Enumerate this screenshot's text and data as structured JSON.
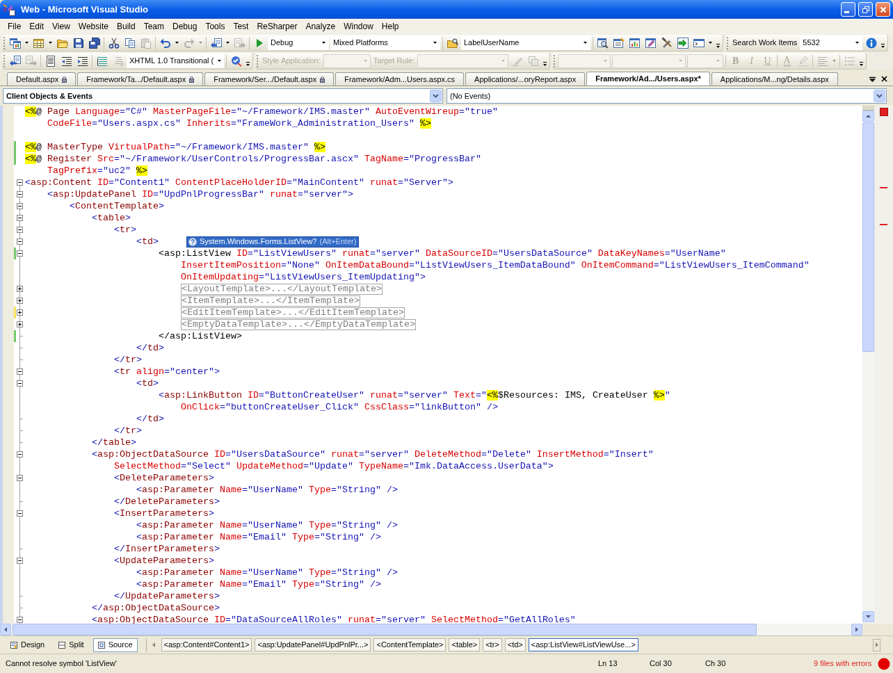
{
  "window": {
    "title": "Web - Microsoft Visual Studio"
  },
  "menu": [
    "File",
    "Edit",
    "View",
    "Website",
    "Build",
    "Team",
    "Debug",
    "Tools",
    "Test",
    "ReSharper",
    "Analyze",
    "Window",
    "Help"
  ],
  "toolbar_rows": [
    {
      "toolbars": [
        {
          "items": [
            {
              "kind": "button",
              "dropdown": true,
              "disabled": false
            },
            {
              "kind": "button",
              "dropdown": true,
              "disabled": false
            },
            {
              "kind": "button",
              "dropdown": false,
              "disabled": false
            },
            {
              "kind": "button",
              "dropdown": false,
              "disabled": false
            },
            {
              "kind": "button",
              "dropdown": false,
              "disabled": false
            },
            {
              "kind": "separator"
            },
            {
              "kind": "button",
              "dropdown": false,
              "disabled": false
            },
            {
              "kind": "button",
              "dropdown": false,
              "disabled": false
            },
            {
              "kind": "button",
              "dropdown": false,
              "disabled": true
            },
            {
              "kind": "separator"
            },
            {
              "kind": "button",
              "dropdown": true,
              "disabled": false
            },
            {
              "kind": "button",
              "dropdown": true,
              "disabled": true
            },
            {
              "kind": "separator"
            },
            {
              "kind": "button",
              "dropdown": true,
              "disabled": false
            },
            {
              "kind": "button",
              "dropdown": false,
              "disabled": true
            },
            {
              "kind": "separator"
            },
            {
              "kind": "button",
              "dropdown": false,
              "disabled": false
            },
            {
              "kind": "combo",
              "value": "Debug",
              "disabled": false
            },
            {
              "kind": "combo",
              "value": "Mixed Platforms",
              "disabled": false
            },
            {
              "kind": "separator"
            },
            {
              "kind": "button",
              "dropdown": false,
              "disabled": false
            },
            {
              "kind": "combo",
              "value": "LabelUserName",
              "disabled": false
            },
            {
              "kind": "separator"
            },
            {
              "kind": "button",
              "dropdown": false,
              "disabled": false
            },
            {
              "kind": "button",
              "dropdown": false,
              "disabled": false
            },
            {
              "kind": "button",
              "dropdown": false,
              "disabled": false
            },
            {
              "kind": "button",
              "dropdown": false,
              "disabled": false
            },
            {
              "kind": "button",
              "dropdown": false,
              "disabled": false
            },
            {
              "kind": "button",
              "dropdown": false,
              "disabled": false
            },
            {
              "kind": "button",
              "dropdown": true,
              "disabled": false
            },
            {
              "kind": "overflow"
            }
          ]
        },
        {
          "items": [
            {
              "kind": "label",
              "text": "Search Work Items",
              "disabled": false
            },
            {
              "kind": "combo",
              "value": "5532",
              "disabled": false
            },
            {
              "kind": "button",
              "dropdown": false,
              "disabled": false
            },
            {
              "kind": "overflow"
            }
          ]
        }
      ]
    },
    {
      "toolbars": [
        {
          "items": [
            {
              "kind": "button",
              "dropdown": false,
              "disabled": false
            },
            {
              "kind": "button",
              "dropdown": false,
              "disabled": true
            },
            {
              "kind": "separator"
            },
            {
              "kind": "button",
              "dropdown": false,
              "disabled": false
            },
            {
              "kind": "button",
              "dropdown": false,
              "disabled": false
            },
            {
              "kind": "button",
              "dropdown": false,
              "disabled": false
            },
            {
              "kind": "separator"
            },
            {
              "kind": "button",
              "dropdown": false,
              "disabled": false
            },
            {
              "kind": "button",
              "dropdown": false,
              "disabled": true
            },
            {
              "kind": "combo",
              "value": "XHTML 1.0 Transitional (",
              "disabled": false
            },
            {
              "kind": "separator"
            },
            {
              "kind": "button",
              "dropdown": false,
              "disabled": false
            },
            {
              "kind": "overflow"
            }
          ]
        },
        {
          "items": [
            {
              "kind": "label",
              "text": "Style Application:",
              "disabled": true
            },
            {
              "kind": "combo",
              "disabled": true
            },
            {
              "kind": "label",
              "text": "Target Rule:",
              "disabled": true
            },
            {
              "kind": "combo",
              "disabled": true
            },
            {
              "kind": "button",
              "dropdown": false,
              "disabled": true
            },
            {
              "kind": "button",
              "dropdown": false,
              "disabled": true
            },
            {
              "kind": "overflow"
            }
          ]
        },
        {
          "items": [
            {
              "kind": "combo",
              "disabled": true
            },
            {
              "kind": "combo",
              "disabled": true
            },
            {
              "kind": "combo",
              "disabled": true
            },
            {
              "kind": "separator"
            },
            {
              "kind": "text_button",
              "label": "B",
              "disabled": true
            },
            {
              "kind": "text_button",
              "label": "I",
              "disabled": true
            },
            {
              "kind": "text_button",
              "label": "U",
              "disabled": true
            },
            {
              "kind": "separator"
            },
            {
              "kind": "text_button",
              "label": "A",
              "disabled": true
            },
            {
              "kind": "button",
              "dropdown": false,
              "disabled": true
            },
            {
              "kind": "separator"
            },
            {
              "kind": "button",
              "dropdown": true,
              "disabled": true
            },
            {
              "kind": "separator"
            },
            {
              "kind": "button",
              "dropdown": false,
              "disabled": true
            },
            {
              "kind": "overflow"
            }
          ]
        }
      ]
    }
  ],
  "tabs": [
    {
      "label": "Default.aspx",
      "locked": true,
      "selected": false
    },
    {
      "label": "Framework/Ta.../Default.aspx",
      "locked": true,
      "selected": false
    },
    {
      "label": "Framework/Ser.../Default.aspx",
      "locked": true,
      "selected": false
    },
    {
      "label": "Framework/Adm...Users.aspx.cs",
      "locked": false,
      "selected": false
    },
    {
      "label": "Applications/...oryReport.aspx",
      "locked": false,
      "selected": false
    },
    {
      "label": "Framework/Ad.../Users.aspx*",
      "locked": false,
      "selected": true
    },
    {
      "label": "Applications/M...ng/Details.aspx",
      "locked": false,
      "selected": false
    }
  ],
  "navigation": {
    "objects": "Client Objects & Events",
    "events": "(No Events)"
  },
  "editor": {
    "lines": [
      {
        "kind": "plain",
        "tokens": [
          {
            "kind": "delimiter",
            "text": "<%"
          },
          {
            "kind": "text",
            "text": "@"
          },
          {
            "kind": "element",
            "text": " Page"
          },
          {
            "kind": "attribute",
            "text": " Language"
          },
          {
            "kind": "markup",
            "text": "=\"C#\""
          },
          {
            "kind": "attribute",
            "text": " MasterPageFile"
          },
          {
            "kind": "markup",
            "text": "=\"~/Framework/IMS.master\""
          },
          {
            "kind": "attribute",
            "text": " AutoEventWireup"
          },
          {
            "kind": "markup",
            "text": "=\"true\""
          }
        ]
      },
      {
        "kind": "plain",
        "tokens": [
          {
            "kind": "attribute",
            "text": "    CodeFile"
          },
          {
            "kind": "markup",
            "text": "=\"Users.aspx.cs\""
          },
          {
            "kind": "attribute",
            "text": " Inherits"
          },
          {
            "kind": "markup",
            "text": "=\"FrameWork_Administration_Users\" "
          },
          {
            "kind": "delimiter",
            "text": "%>"
          }
        ]
      },
      {
        "kind": "plain"
      },
      {
        "kind": "plain",
        "color": "#74c96a",
        "tokens": [
          {
            "kind": "delimiter",
            "text": "<%"
          },
          {
            "kind": "text",
            "text": "@"
          },
          {
            "kind": "element",
            "text": " MasterType"
          },
          {
            "kind": "attribute",
            "text": " VirtualPath"
          },
          {
            "kind": "markup",
            "text": "=\"~/Framework/IMS.master\" "
          },
          {
            "kind": "delimiter",
            "text": "%>"
          }
        ]
      },
      {
        "kind": "plain",
        "color": "#74c96a",
        "tokens": [
          {
            "kind": "delimiter",
            "text": "<%"
          },
          {
            "kind": "text",
            "text": "@"
          },
          {
            "kind": "element",
            "text": " Register"
          },
          {
            "kind": "attribute",
            "text": " Src"
          },
          {
            "kind": "markup",
            "text": "=\"~/Framework/UserControls/ProgressBar.ascx\""
          },
          {
            "kind": "attribute",
            "text": " TagName"
          },
          {
            "kind": "markup",
            "text": "=\"ProgressBar\""
          }
        ]
      },
      {
        "kind": "plain",
        "tokens": [
          {
            "kind": "attribute",
            "text": "    TagPrefix"
          },
          {
            "kind": "markup",
            "text": "=\"uc2\" "
          },
          {
            "kind": "delimiter",
            "text": "%>"
          }
        ]
      },
      {
        "kind": "start",
        "expanded": true,
        "tokens": [
          {
            "kind": "markup",
            "text": "<"
          },
          {
            "kind": "element",
            "text": "asp:Content"
          },
          {
            "kind": "attribute",
            "text": " ID"
          },
          {
            "kind": "markup",
            "text": "=\"Content1\""
          },
          {
            "kind": "attribute",
            "text": " ContentPlaceHolderID"
          },
          {
            "kind": "markup",
            "text": "=\"MainContent\""
          },
          {
            "kind": "attribute",
            "text": " runat"
          },
          {
            "kind": "markup",
            "text": "=\"Server\">"
          }
        ]
      },
      {
        "kind": "start",
        "expanded": true,
        "tokens": [
          {
            "kind": "markup",
            "text": "    <"
          },
          {
            "kind": "element",
            "text": "asp:UpdatePanel"
          },
          {
            "kind": "attribute",
            "text": " ID"
          },
          {
            "kind": "markup",
            "text": "=\"UpdPnlProgressBar\""
          },
          {
            "kind": "attribute",
            "text": " runat"
          },
          {
            "kind": "markup",
            "text": "=\"server\">"
          }
        ]
      },
      {
        "kind": "start",
        "expanded": true,
        "tokens": [
          {
            "kind": "markup",
            "text": "        <"
          },
          {
            "kind": "element",
            "text": "ContentTemplate"
          },
          {
            "kind": "markup",
            "text": ">"
          }
        ]
      },
      {
        "kind": "start",
        "expanded": true,
        "tokens": [
          {
            "kind": "markup",
            "text": "            <"
          },
          {
            "kind": "element",
            "text": "table"
          },
          {
            "kind": "markup",
            "text": ">"
          }
        ]
      },
      {
        "kind": "start",
        "expanded": true,
        "tokens": [
          {
            "kind": "markup",
            "text": "                <"
          },
          {
            "kind": "element",
            "text": "tr"
          },
          {
            "kind": "markup",
            "text": ">"
          }
        ]
      },
      {
        "kind": "start",
        "expanded": true,
        "tokens": [
          {
            "kind": "markup",
            "text": "                    <"
          },
          {
            "kind": "element",
            "text": "td"
          },
          {
            "kind": "markup",
            "text": ">"
          }
        ],
        "quick_fix": {
          "text": "System.Windows.Forms.ListView?",
          "shortcut": "(Alt+Enter)"
        }
      },
      {
        "kind": "start",
        "expanded": true,
        "color": "#74c96a",
        "tokens": [
          {
            "kind": "matched",
            "text": "                        <asp:ListView"
          },
          {
            "kind": "attribute",
            "text": " ID"
          },
          {
            "kind": "markup",
            "text": "=\"ListViewUsers\""
          },
          {
            "kind": "attribute",
            "text": " runat"
          },
          {
            "kind": "markup",
            "text": "=\"server\""
          },
          {
            "kind": "attribute",
            "text": " DataSourceID"
          },
          {
            "kind": "markup",
            "text": "=\"UsersDataSource\""
          },
          {
            "kind": "attribute",
            "text": " DataKeyNames"
          },
          {
            "kind": "markup",
            "text": "=\"UserName\""
          }
        ]
      },
      {
        "kind": "inside",
        "tokens": [
          {
            "kind": "attribute",
            "text": "                            InsertItemPosition"
          },
          {
            "kind": "markup",
            "text": "=\"None\""
          },
          {
            "kind": "attribute",
            "text": " OnItemDataBound"
          },
          {
            "kind": "markup",
            "text": "=\"ListViewUsers_ItemDataBound\""
          },
          {
            "kind": "attribute",
            "text": " OnItemCommand"
          },
          {
            "kind": "markup",
            "text": "=\"ListViewUsers_ItemCommand\""
          }
        ]
      },
      {
        "kind": "inside",
        "tokens": [
          {
            "kind": "attribute",
            "text": "                            OnItemUpdating"
          },
          {
            "kind": "markup",
            "text": "=\"ListViewUsers_ItemUpdating\">"
          }
        ]
      },
      {
        "kind": "start",
        "expanded": false,
        "tokens": [
          {
            "kind": "collapsed",
            "text": "                            <LayoutTemplate>...</LayoutTemplate>"
          }
        ]
      },
      {
        "kind": "start",
        "expanded": false,
        "tokens": [
          {
            "kind": "collapsed",
            "text": "                            <ItemTemplate>...</ItemTemplate>"
          }
        ]
      },
      {
        "kind": "start",
        "expanded": false,
        "color": "#f6e35c",
        "tokens": [
          {
            "kind": "collapsed",
            "text": "                            <EditItemTemplate>...</EditItemTemplate>"
          }
        ]
      },
      {
        "kind": "start",
        "expanded": false,
        "tokens": [
          {
            "kind": "collapsed",
            "text": "                            <EmptyDataTemplate>...</EmptyDataTemplate>"
          }
        ]
      },
      {
        "kind": "end",
        "color": "#74c96a",
        "tokens": [
          {
            "kind": "matched",
            "text": "                        </asp:ListView>"
          }
        ]
      },
      {
        "kind": "end",
        "tokens": [
          {
            "kind": "markup",
            "text": "                    </"
          },
          {
            "kind": "element",
            "text": "td"
          },
          {
            "kind": "markup",
            "text": ">"
          }
        ]
      },
      {
        "kind": "end",
        "tokens": [
          {
            "kind": "markup",
            "text": "                </"
          },
          {
            "kind": "element",
            "text": "tr"
          },
          {
            "kind": "markup",
            "text": ">"
          }
        ]
      },
      {
        "kind": "start",
        "expanded": true,
        "tokens": [
          {
            "kind": "markup",
            "text": "                <"
          },
          {
            "kind": "element",
            "text": "tr"
          },
          {
            "kind": "attribute",
            "text": " align"
          },
          {
            "kind": "markup",
            "text": "=\"center\">"
          }
        ]
      },
      {
        "kind": "start",
        "expanded": true,
        "tokens": [
          {
            "kind": "markup",
            "text": "                    <"
          },
          {
            "kind": "element",
            "text": "td"
          },
          {
            "kind": "markup",
            "text": ">"
          }
        ]
      },
      {
        "kind": "inside",
        "tokens": [
          {
            "kind": "markup",
            "text": "                        <"
          },
          {
            "kind": "element",
            "text": "asp:LinkButton"
          },
          {
            "kind": "attribute",
            "text": " ID"
          },
          {
            "kind": "markup",
            "text": "=\"ButtonCreateUser\""
          },
          {
            "kind": "attribute",
            "text": " runat"
          },
          {
            "kind": "markup",
            "text": "=\"server\""
          },
          {
            "kind": "attribute",
            "text": " Text"
          },
          {
            "kind": "markup",
            "text": "=\""
          },
          {
            "kind": "delimiter",
            "text": "<%"
          },
          {
            "kind": "text",
            "text": "$Resources: IMS, CreateUser "
          },
          {
            "kind": "delimiter",
            "text": "%>"
          },
          {
            "kind": "markup",
            "text": "\""
          }
        ]
      },
      {
        "kind": "inside",
        "tokens": [
          {
            "kind": "attribute",
            "text": "                            OnClick"
          },
          {
            "kind": "markup",
            "text": "=\"buttonCreateUser_Click\""
          },
          {
            "kind": "attribute",
            "text": " CssClass"
          },
          {
            "kind": "markup",
            "text": "=\"linkButton\" />"
          }
        ]
      },
      {
        "kind": "end",
        "tokens": [
          {
            "kind": "markup",
            "text": "                    </"
          },
          {
            "kind": "element",
            "text": "td"
          },
          {
            "kind": "markup",
            "text": ">"
          }
        ]
      },
      {
        "kind": "end",
        "tokens": [
          {
            "kind": "markup",
            "text": "                </"
          },
          {
            "kind": "element",
            "text": "tr"
          },
          {
            "kind": "markup",
            "text": ">"
          }
        ]
      },
      {
        "kind": "end",
        "tokens": [
          {
            "kind": "markup",
            "text": "            </"
          },
          {
            "kind": "element",
            "text": "table"
          },
          {
            "kind": "markup",
            "text": ">"
          }
        ]
      },
      {
        "kind": "start",
        "expanded": true,
        "tokens": [
          {
            "kind": "markup",
            "text": "            <"
          },
          {
            "kind": "element",
            "text": "asp:ObjectDataSource"
          },
          {
            "kind": "attribute",
            "text": " ID"
          },
          {
            "kind": "markup",
            "text": "=\"UsersDataSource\""
          },
          {
            "kind": "attribute",
            "text": " runat"
          },
          {
            "kind": "markup",
            "text": "=\"server\""
          },
          {
            "kind": "attribute",
            "text": " DeleteMethod"
          },
          {
            "kind": "markup",
            "text": "=\"Delete\""
          },
          {
            "kind": "attribute",
            "text": " InsertMethod"
          },
          {
            "kind": "markup",
            "text": "=\"Insert\""
          }
        ]
      },
      {
        "kind": "inside",
        "tokens": [
          {
            "kind": "attribute",
            "text": "                SelectMethod"
          },
          {
            "kind": "markup",
            "text": "=\"Select\""
          },
          {
            "kind": "attribute",
            "text": " UpdateMethod"
          },
          {
            "kind": "markup",
            "text": "=\"Update\""
          },
          {
            "kind": "attribute",
            "text": " TypeName"
          },
          {
            "kind": "markup",
            "text": "=\"Imk.DataAccess.UserData\">"
          }
        ]
      },
      {
        "kind": "start",
        "expanded": true,
        "tokens": [
          {
            "kind": "markup",
            "text": "                <"
          },
          {
            "kind": "element",
            "text": "DeleteParameters"
          },
          {
            "kind": "markup",
            "text": ">"
          }
        ]
      },
      {
        "kind": "inside",
        "tokens": [
          {
            "kind": "markup",
            "text": "                    <"
          },
          {
            "kind": "element",
            "text": "asp:Parameter"
          },
          {
            "kind": "attribute",
            "text": " Name"
          },
          {
            "kind": "markup",
            "text": "=\"UserName\""
          },
          {
            "kind": "attribute",
            "text": " Type"
          },
          {
            "kind": "markup",
            "text": "=\"String\" />"
          }
        ]
      },
      {
        "kind": "end",
        "tokens": [
          {
            "kind": "markup",
            "text": "                </"
          },
          {
            "kind": "element",
            "text": "DeleteParameters"
          },
          {
            "kind": "markup",
            "text": ">"
          }
        ]
      },
      {
        "kind": "start",
        "expanded": true,
        "tokens": [
          {
            "kind": "markup",
            "text": "                <"
          },
          {
            "kind": "element",
            "text": "InsertParameters"
          },
          {
            "kind": "markup",
            "text": ">"
          }
        ]
      },
      {
        "kind": "inside",
        "tokens": [
          {
            "kind": "markup",
            "text": "                    <"
          },
          {
            "kind": "element",
            "text": "asp:Parameter"
          },
          {
            "kind": "attribute",
            "text": " Name"
          },
          {
            "kind": "markup",
            "text": "=\"UserName\""
          },
          {
            "kind": "attribute",
            "text": " Type"
          },
          {
            "kind": "markup",
            "text": "=\"String\" />"
          }
        ]
      },
      {
        "kind": "inside",
        "tokens": [
          {
            "kind": "markup",
            "text": "                    <"
          },
          {
            "kind": "element",
            "text": "asp:Parameter"
          },
          {
            "kind": "attribute",
            "text": " Name"
          },
          {
            "kind": "markup",
            "text": "=\"Email\""
          },
          {
            "kind": "attribute",
            "text": " Type"
          },
          {
            "kind": "markup",
            "text": "=\"String\" />"
          }
        ]
      },
      {
        "kind": "end",
        "tokens": [
          {
            "kind": "markup",
            "text": "                </"
          },
          {
            "kind": "element",
            "text": "InsertParameters"
          },
          {
            "kind": "markup",
            "text": ">"
          }
        ]
      },
      {
        "kind": "start",
        "expanded": true,
        "tokens": [
          {
            "kind": "markup",
            "text": "                <"
          },
          {
            "kind": "element",
            "text": "UpdateParameters"
          },
          {
            "kind": "markup",
            "text": ">"
          }
        ]
      },
      {
        "kind": "inside",
        "tokens": [
          {
            "kind": "markup",
            "text": "                    <"
          },
          {
            "kind": "element",
            "text": "asp:Parameter"
          },
          {
            "kind": "attribute",
            "text": " Name"
          },
          {
            "kind": "markup",
            "text": "=\"UserName\""
          },
          {
            "kind": "attribute",
            "text": " Type"
          },
          {
            "kind": "markup",
            "text": "=\"String\" />"
          }
        ]
      },
      {
        "kind": "inside",
        "tokens": [
          {
            "kind": "markup",
            "text": "                    <"
          },
          {
            "kind": "element",
            "text": "asp:Parameter"
          },
          {
            "kind": "attribute",
            "text": " Name"
          },
          {
            "kind": "markup",
            "text": "=\"Email\""
          },
          {
            "kind": "attribute",
            "text": " Type"
          },
          {
            "kind": "markup",
            "text": "=\"String\" />"
          }
        ]
      },
      {
        "kind": "end",
        "tokens": [
          {
            "kind": "markup",
            "text": "                </"
          },
          {
            "kind": "element",
            "text": "UpdateParameters"
          },
          {
            "kind": "markup",
            "text": ">"
          }
        ]
      },
      {
        "kind": "end",
        "tokens": [
          {
            "kind": "markup",
            "text": "            </"
          },
          {
            "kind": "element",
            "text": "asp:ObjectDataSource"
          },
          {
            "kind": "markup",
            "text": ">"
          }
        ]
      },
      {
        "kind": "start",
        "expanded": true,
        "tokens": [
          {
            "kind": "markup",
            "text": "            <"
          },
          {
            "kind": "element",
            "text": "asp:ObjectDataSource"
          },
          {
            "kind": "attribute",
            "text": " ID"
          },
          {
            "kind": "markup",
            "text": "=\"DataSourceAllRoles\""
          },
          {
            "kind": "attribute",
            "text": " runat"
          },
          {
            "kind": "markup",
            "text": "=\"server\""
          },
          {
            "kind": "attribute",
            "text": " SelectMethod"
          },
          {
            "kind": "markup",
            "text": "=\"GetAllRoles\""
          }
        ]
      }
    ]
  },
  "view_tabs": [
    {
      "label": "Design",
      "selected": false
    },
    {
      "label": "Split",
      "selected": false
    },
    {
      "label": "Source",
      "selected": true
    }
  ],
  "breadcrumb": [
    {
      "label": "<asp:Content#Content1>",
      "selected": false
    },
    {
      "label": "<asp:UpdatePanel#UpdPnlPr...>",
      "selected": false
    },
    {
      "label": "<ContentTemplate>",
      "selected": false
    },
    {
      "label": "<table>",
      "selected": false
    },
    {
      "label": "<tr>",
      "selected": false
    },
    {
      "label": "<td>",
      "selected": false
    },
    {
      "label": "<asp:ListView#ListViewUse...>",
      "selected": true
    }
  ],
  "status_bar": {
    "message": "Cannot resolve symbol 'ListView'",
    "line": "Ln 13",
    "column": "Col 30",
    "character": "Ch 30",
    "errors": "9 files with errors"
  }
}
